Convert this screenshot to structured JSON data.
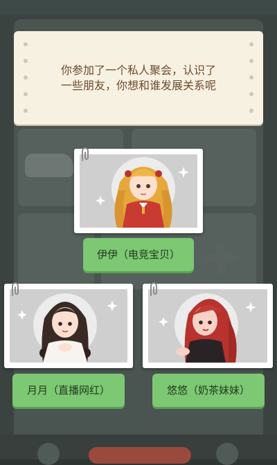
{
  "question": {
    "line1": "你参加了一个私人聚会，认识了",
    "line2": "一些朋友，你想和谁发展关系呢"
  },
  "choices": [
    {
      "label": "伊伊（电竞宝贝）",
      "icon": "girl-blonde-portrait"
    },
    {
      "label": "月月（直播网红）",
      "icon": "girl-brunette-portrait"
    },
    {
      "label": "悠悠（奶茶妹妹）",
      "icon": "girl-redhead-portrait"
    }
  ],
  "colors": {
    "card": "#f7f1e1",
    "question_text": "#6b4b2e",
    "button": "#7dc873",
    "overlay": "#3b4340"
  }
}
